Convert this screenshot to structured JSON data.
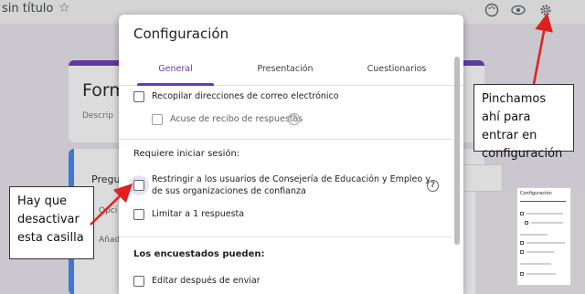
{
  "background": {
    "doc_title": "sin título",
    "form_title": "Form",
    "form_desc": "Descrip",
    "question_label": "Pregu",
    "bg_texts": [
      "Opci",
      "Añad"
    ]
  },
  "dialog": {
    "title": "Configuración",
    "tabs": [
      "General",
      "Presentación",
      "Cuestionarios"
    ],
    "active_tab": "General",
    "items": {
      "collect_emails": "Recopilar direcciones de correo electrónico",
      "receipt": "Acuse de recibo de respuestas",
      "require_signin_head": "Requiere iniciar sesión:",
      "restrict": "Restringir a los usuarios de Consejería de Educación y Empleo y de sus organizaciones de confianza",
      "limit_one": "Limitar a 1 respuesta",
      "respondents_head": "Los encuestados pueden:",
      "edit_after": "Editar después de enviar"
    },
    "help_icon": "?"
  },
  "callouts": {
    "left": "Hay que desactivar esta casilla",
    "right": "Pinchamos ahí para entrar en configuración"
  },
  "thumbnail": {
    "title": "Configuración"
  },
  "colors": {
    "accent": "#673ab7",
    "arrow": "#e02020"
  }
}
